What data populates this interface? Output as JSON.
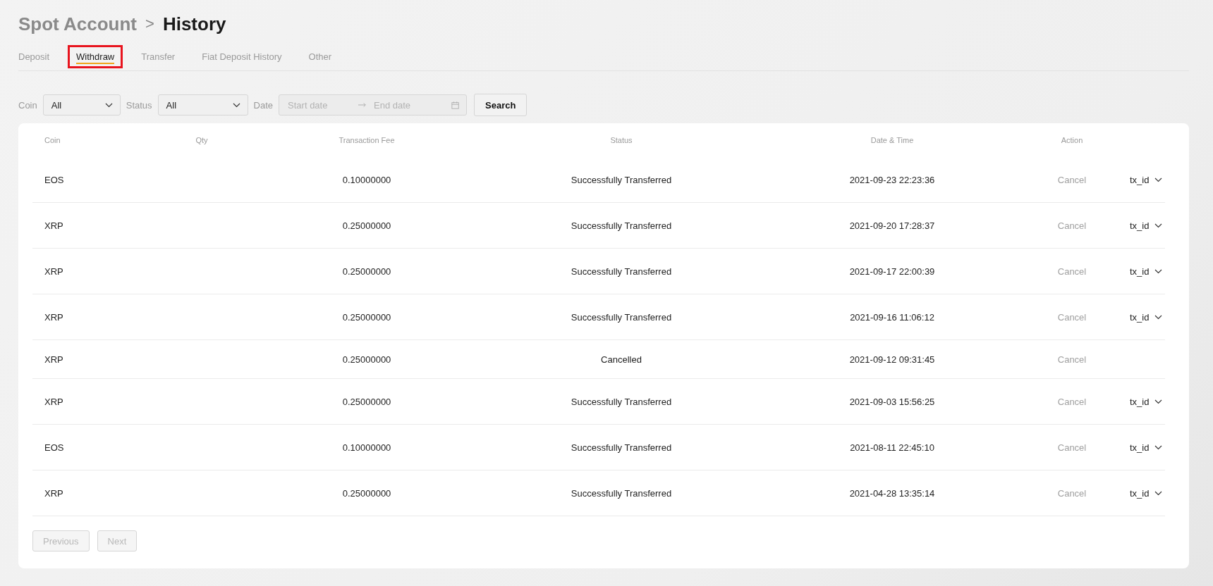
{
  "breadcrumb": {
    "parent": "Spot Account",
    "separator": ">",
    "current": "History"
  },
  "tabs": [
    {
      "label": "Deposit",
      "selected": false
    },
    {
      "label": "Withdraw",
      "selected": true,
      "highlighted": true
    },
    {
      "label": "Transfer",
      "selected": false
    },
    {
      "label": "Fiat Deposit History",
      "selected": false
    },
    {
      "label": "Other",
      "selected": false
    }
  ],
  "filters": {
    "coin": {
      "label": "Coin",
      "value": "All"
    },
    "status": {
      "label": "Status",
      "value": "All"
    },
    "date": {
      "label": "Date",
      "start_placeholder": "Start date",
      "end_placeholder": "End date"
    },
    "search_button": "Search"
  },
  "table": {
    "columns": [
      "Coin",
      "Qty",
      "Transaction Fee",
      "Status",
      "Date & Time",
      "Action"
    ],
    "rows": [
      {
        "coin": "EOS",
        "fee": "0.10000000",
        "status": "Successfully Transferred",
        "datetime": "2021-09-23 22:23:36",
        "action": "Cancel",
        "tx": "tx_id"
      },
      {
        "coin": "XRP",
        "fee": "0.25000000",
        "status": "Successfully Transferred",
        "datetime": "2021-09-20 17:28:37",
        "action": "Cancel",
        "tx": "tx_id"
      },
      {
        "coin": "XRP",
        "fee": "0.25000000",
        "status": "Successfully Transferred",
        "datetime": "2021-09-17 22:00:39",
        "action": "Cancel",
        "tx": "tx_id"
      },
      {
        "coin": "XRP",
        "fee": "0.25000000",
        "status": "Successfully Transferred",
        "datetime": "2021-09-16 11:06:12",
        "action": "Cancel",
        "tx": "tx_id"
      },
      {
        "coin": "XRP",
        "fee": "0.25000000",
        "status": "Cancelled",
        "datetime": "2021-09-12 09:31:45",
        "action": "Cancel"
      },
      {
        "coin": "XRP",
        "fee": "0.25000000",
        "status": "Successfully Transferred",
        "datetime": "2021-09-03 15:56:25",
        "action": "Cancel",
        "tx": "tx_id"
      },
      {
        "coin": "EOS",
        "fee": "0.10000000",
        "status": "Successfully Transferred",
        "datetime": "2021-08-11 22:45:10",
        "action": "Cancel",
        "tx": "tx_id"
      },
      {
        "coin": "XRP",
        "fee": "0.25000000",
        "status": "Successfully Transferred",
        "datetime": "2021-04-28 13:35:14",
        "action": "Cancel",
        "tx": "tx_id"
      }
    ]
  },
  "pagination": [
    {
      "label": "Previous",
      "disabled": true
    },
    {
      "label": "Next",
      "disabled": true
    }
  ]
}
